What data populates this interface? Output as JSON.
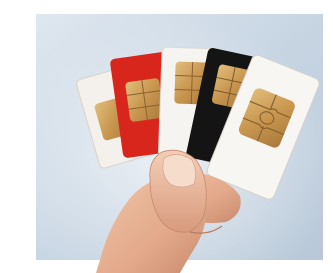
{
  "photo": {
    "subject": "hand-holding-sim-cards",
    "cards": [
      {
        "name": "sim-card-white-back",
        "color": "#f4f1ec"
      },
      {
        "name": "sim-card-red",
        "color": "#d9261c"
      },
      {
        "name": "sim-card-white-middle",
        "color": "#f6f4f0"
      },
      {
        "name": "sim-card-black",
        "color": "#141414"
      },
      {
        "name": "sim-card-white-front",
        "color": "#f7f6f3"
      }
    ],
    "colors": {
      "background": "#ffffff",
      "backdrop": "#c9d6e3",
      "chip_gold": "#c99a55",
      "skin": "#e8b497"
    }
  }
}
